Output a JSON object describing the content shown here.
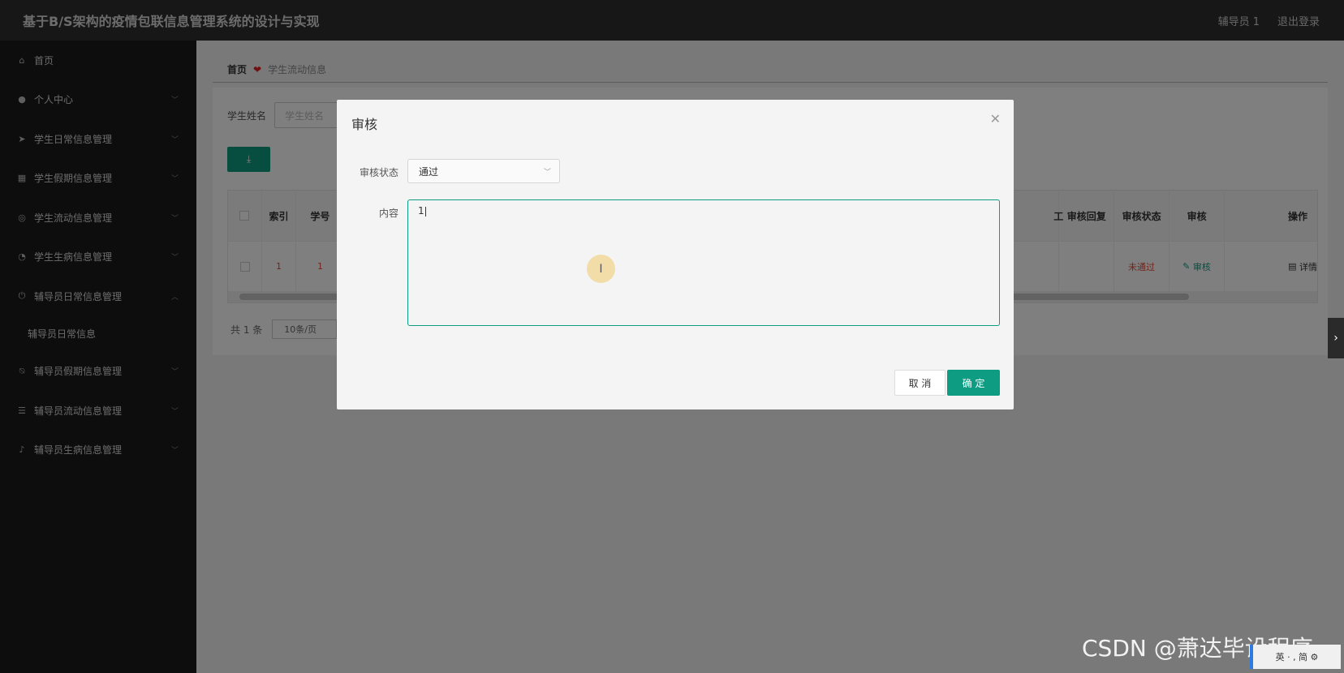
{
  "header": {
    "title": "基于B/S架构的疫情包联信息管理系统的设计与实现",
    "user": "辅导员 1",
    "logout": "退出登录"
  },
  "sidebar": {
    "items": [
      {
        "label": "首页",
        "icon": "home-icon",
        "glyph": "⌂"
      },
      {
        "label": "个人中心",
        "icon": "user-icon",
        "glyph": "👤"
      },
      {
        "label": "学生日常信息管理",
        "icon": "send-icon",
        "glyph": "➤"
      },
      {
        "label": "学生假期信息管理",
        "icon": "grid-icon",
        "glyph": "▦"
      },
      {
        "label": "学生流动信息管理",
        "icon": "compass-icon",
        "glyph": "◎"
      },
      {
        "label": "学生生病信息管理",
        "icon": "gauge-icon",
        "glyph": "◔"
      },
      {
        "label": "辅导员日常信息管理",
        "icon": "power-icon",
        "glyph": "⏻"
      },
      {
        "label": "辅导员日常信息"
      },
      {
        "label": "辅导员假期信息管理",
        "icon": "bell-off-icon",
        "glyph": "🔕"
      },
      {
        "label": "辅导员流动信息管理",
        "icon": "list-icon",
        "glyph": "☰"
      },
      {
        "label": "辅导员生病信息管理",
        "icon": "mic-icon",
        "glyph": "🎤"
      }
    ]
  },
  "breadcrumb": {
    "home": "首页",
    "current": "学生流动信息"
  },
  "search": {
    "label": "学生姓名",
    "placeholder": "学生姓名"
  },
  "download_button": {
    "icon": "download-icon",
    "glyph": "⤓"
  },
  "table": {
    "headers": [
      "索引",
      "学号",
      "工",
      "审核回复",
      "审核状态",
      "审核",
      "操作"
    ],
    "row": {
      "index": "1",
      "student_id": "1",
      "status": "未通过",
      "review": "审核",
      "detail": "详情"
    }
  },
  "pager": {
    "total": "共 1 条",
    "page_size": "10条/页"
  },
  "dialog": {
    "title": "审核",
    "status_label": "审核状态",
    "status_value": "通过",
    "content_label": "内容",
    "content_value": "1",
    "cancel": "取 消",
    "confirm": "确 定"
  },
  "watermark": "CSDN @萧达毕设程序",
  "ime": "英 · , 简 ⚙"
}
